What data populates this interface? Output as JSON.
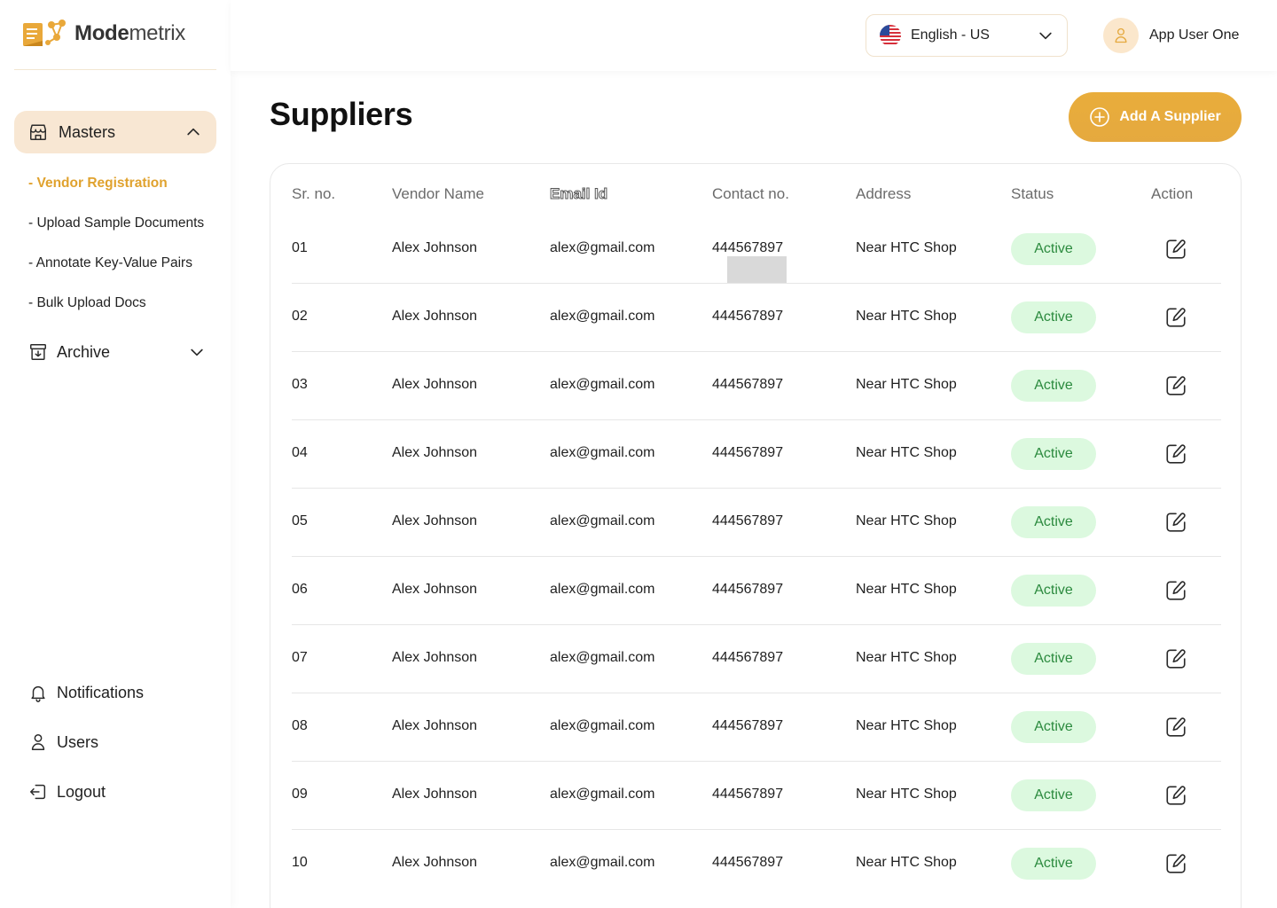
{
  "app": {
    "logo_bold": "Mode",
    "logo_rest": "metrix"
  },
  "sidebar": {
    "masters_label": "Masters",
    "sub_items": [
      {
        "label": "- Vendor Registration",
        "active": true
      },
      {
        "label": "- Upload Sample Documents",
        "active": false
      },
      {
        "label": "- Annotate Key-Value Pairs",
        "active": false
      },
      {
        "label": "- Bulk Upload Docs",
        "active": false
      }
    ],
    "archive_label": "Archive",
    "bottom_items": [
      {
        "label": "Notifications",
        "icon": "bell-icon"
      },
      {
        "label": "Users",
        "icon": "user-icon"
      },
      {
        "label": "Logout",
        "icon": "logout-icon"
      }
    ]
  },
  "topbar": {
    "language": "English - US",
    "user_name": "App User One"
  },
  "page": {
    "title": "Suppliers",
    "add_button": "Add A Supplier"
  },
  "table": {
    "headers": [
      "Sr. no.",
      "Vendor Name",
      "Email Id",
      "Contact no.",
      "Address",
      "Status",
      "Action"
    ],
    "rows": [
      {
        "sr": "01",
        "name": "Alex Johnson",
        "email": "alex@gmail.com",
        "contact": "444567897",
        "address": "Near HTC Shop",
        "status": "Active"
      },
      {
        "sr": "02",
        "name": "Alex Johnson",
        "email": "alex@gmail.com",
        "contact": "444567897",
        "address": "Near HTC Shop",
        "status": "Active"
      },
      {
        "sr": "03",
        "name": "Alex Johnson",
        "email": "alex@gmail.com",
        "contact": "444567897",
        "address": "Near HTC Shop",
        "status": "Active"
      },
      {
        "sr": "04",
        "name": "Alex Johnson",
        "email": "alex@gmail.com",
        "contact": "444567897",
        "address": "Near HTC Shop",
        "status": "Active"
      },
      {
        "sr": "05",
        "name": "Alex Johnson",
        "email": "alex@gmail.com",
        "contact": "444567897",
        "address": "Near HTC Shop",
        "status": "Active"
      },
      {
        "sr": "06",
        "name": "Alex Johnson",
        "email": "alex@gmail.com",
        "contact": "444567897",
        "address": "Near HTC Shop",
        "status": "Active"
      },
      {
        "sr": "07",
        "name": "Alex Johnson",
        "email": "alex@gmail.com",
        "contact": "444567897",
        "address": "Near HTC Shop",
        "status": "Active"
      },
      {
        "sr": "08",
        "name": "Alex Johnson",
        "email": "alex@gmail.com",
        "contact": "444567897",
        "address": "Near HTC Shop",
        "status": "Active"
      },
      {
        "sr": "09",
        "name": "Alex Johnson",
        "email": "alex@gmail.com",
        "contact": "444567897",
        "address": "Near HTC Shop",
        "status": "Active"
      },
      {
        "sr": "10",
        "name": "Alex Johnson",
        "email": "alex@gmail.com",
        "contact": "444567897",
        "address": "Near HTC Shop",
        "status": "Active"
      }
    ]
  },
  "colors": {
    "accent": "#e5a93f",
    "active_nav_bg": "#f8e7d3",
    "status_bg": "#dcf9df",
    "status_text": "#2b8a3e"
  }
}
